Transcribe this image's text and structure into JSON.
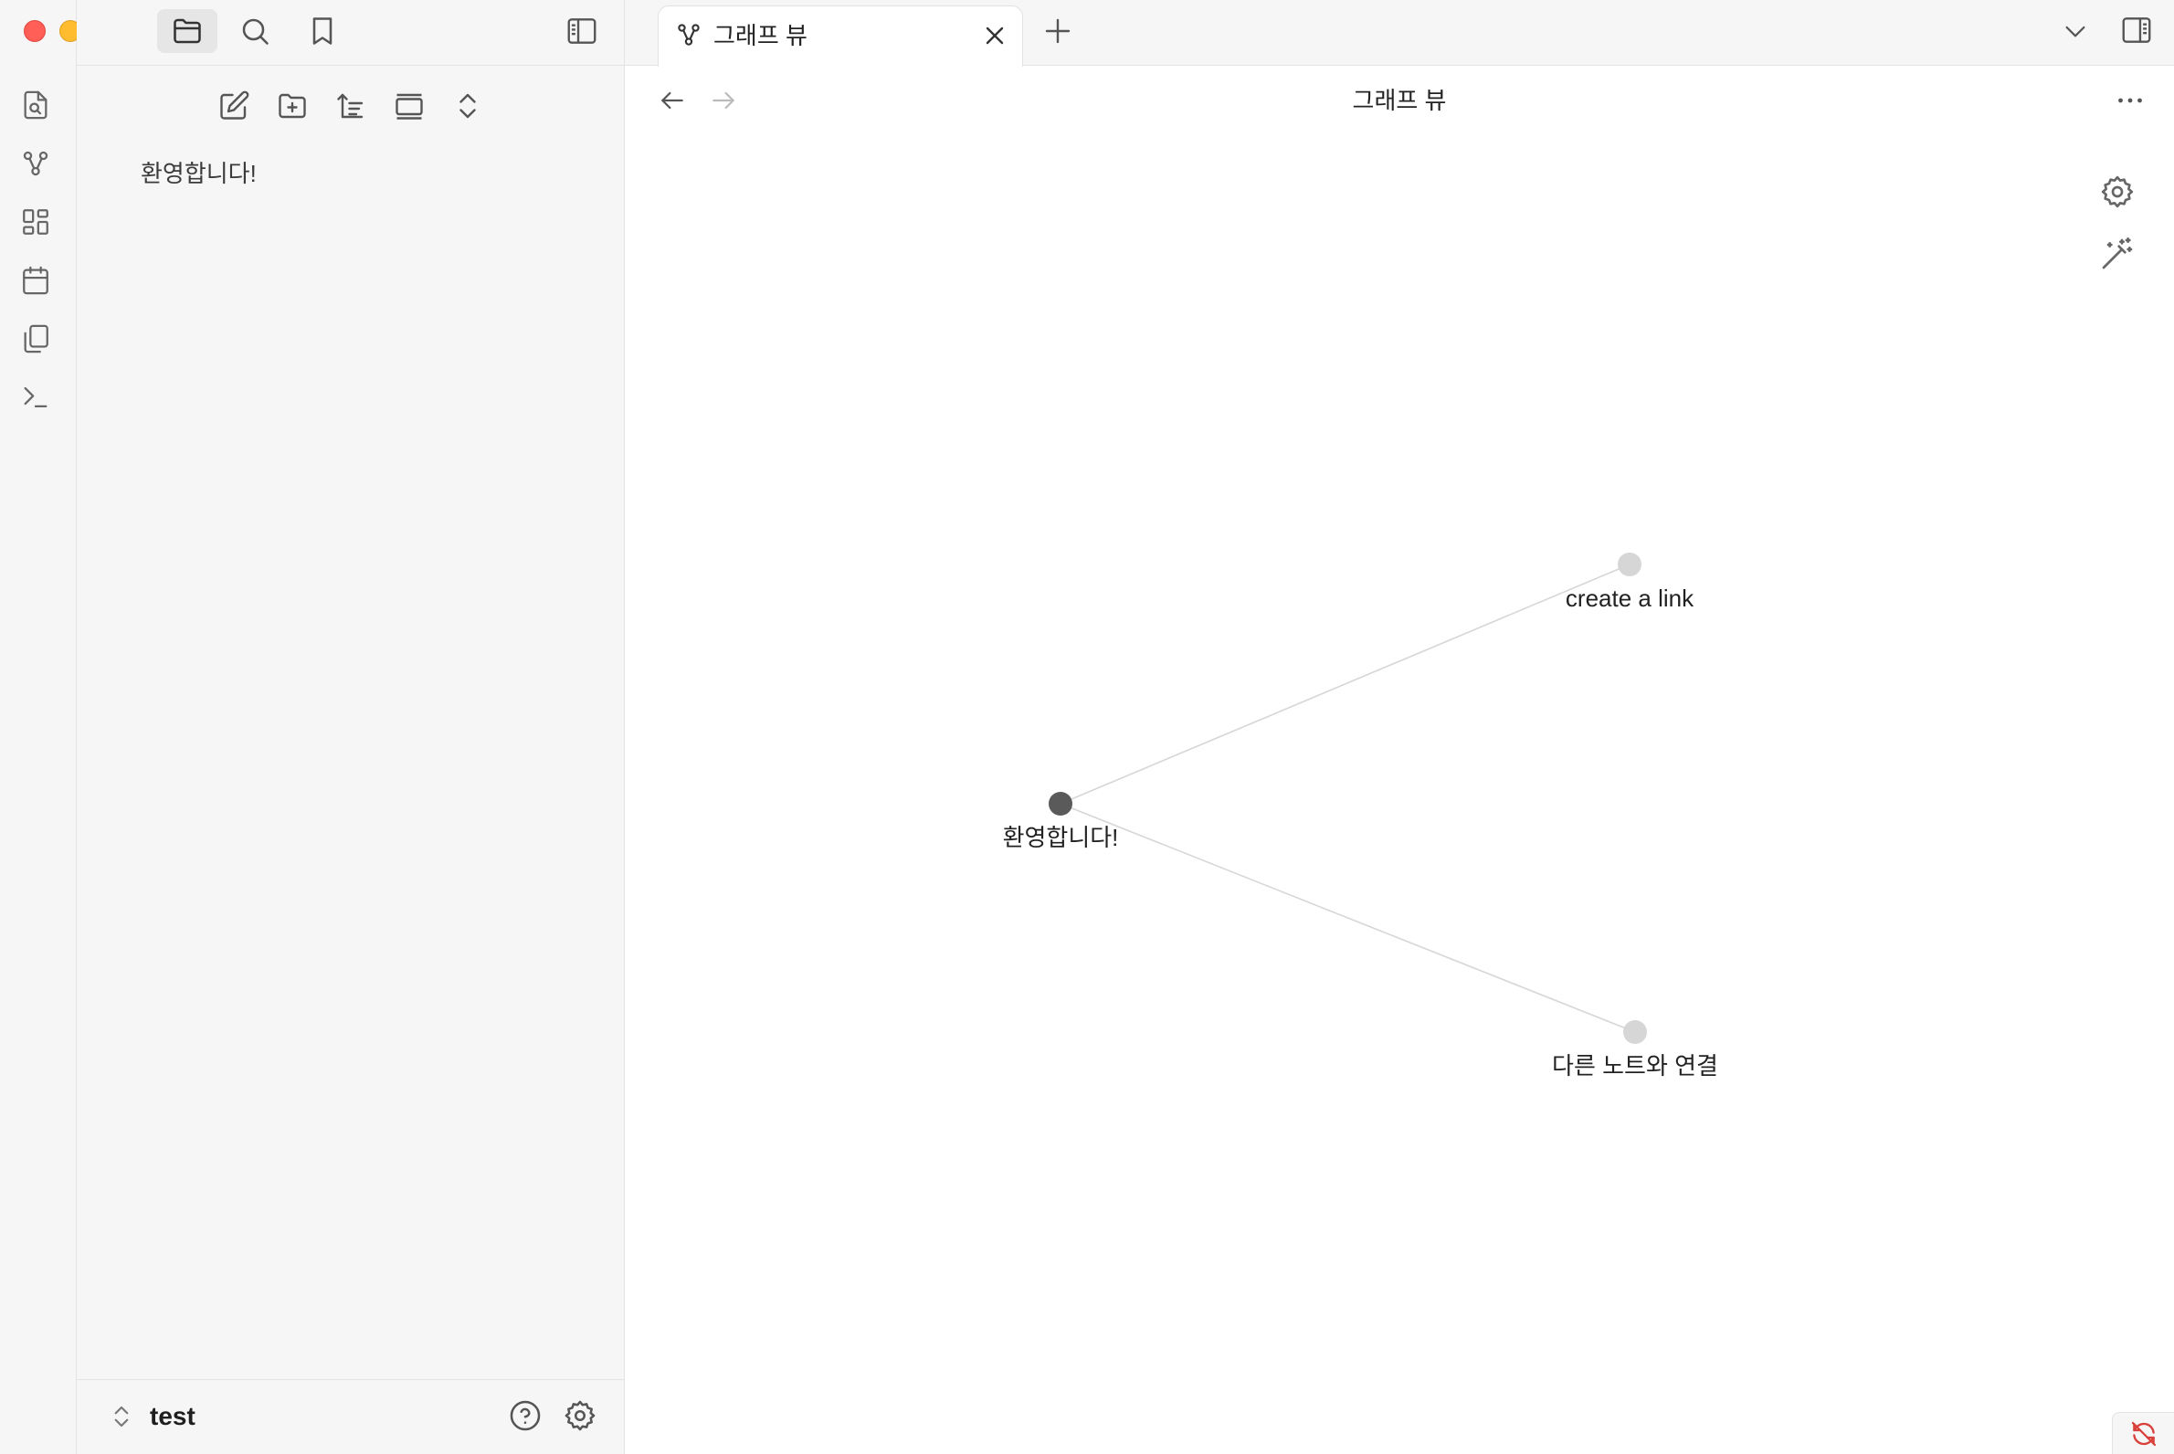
{
  "window": {
    "traffic_lights": {
      "close": "#ff5f57",
      "minimize": "#febc2e",
      "zoom": "#28c840"
    }
  },
  "ribbon": {
    "items": [
      {
        "name": "open-quick-switcher",
        "icon": "file-search-icon"
      },
      {
        "name": "open-graph-view",
        "icon": "graph-icon"
      },
      {
        "name": "open-canvas",
        "icon": "layout-dashboard-icon"
      },
      {
        "name": "open-daily-note",
        "icon": "calendar-icon"
      },
      {
        "name": "insert-template",
        "icon": "copy-icon"
      },
      {
        "name": "command-palette",
        "icon": "terminal-icon"
      }
    ]
  },
  "sidebar": {
    "top_tabs": [
      {
        "name": "files",
        "icon": "folder-icon",
        "active": true
      },
      {
        "name": "search",
        "icon": "search-icon",
        "active": false
      },
      {
        "name": "bookmarks",
        "icon": "bookmark-icon",
        "active": false
      }
    ],
    "nav_actions": [
      {
        "name": "new-note",
        "icon": "edit-icon"
      },
      {
        "name": "new-folder",
        "icon": "folder-plus-icon"
      },
      {
        "name": "sort",
        "icon": "sort-icon"
      },
      {
        "name": "auto-reveal",
        "icon": "panel-icon"
      },
      {
        "name": "collapse-all",
        "icon": "chevrons-up-down-icon"
      }
    ],
    "files": [
      {
        "label": "환영합니다!"
      }
    ],
    "vault": {
      "name": "test"
    }
  },
  "main": {
    "tab": {
      "label": "그래프 뷰",
      "icon": "graph-icon"
    },
    "view_title": "그래프 뷰",
    "graph": {
      "accent": "#5a5a5a",
      "nodes": [
        {
          "id": "welcome",
          "label": "환영합니다!",
          "active": true
        },
        {
          "id": "create-link",
          "label": "create a link",
          "active": false
        },
        {
          "id": "connect",
          "label": "다른 노트와 연결",
          "active": false
        }
      ],
      "edges": [
        [
          "welcome",
          "create-link"
        ],
        [
          "welcome",
          "connect"
        ]
      ]
    }
  }
}
